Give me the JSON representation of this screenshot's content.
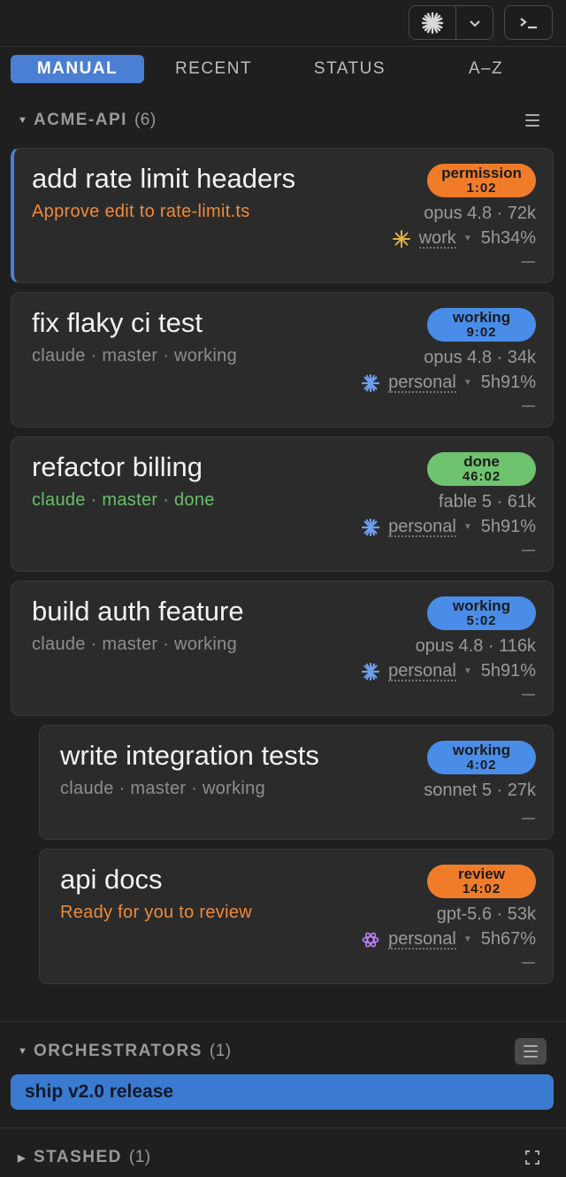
{
  "toolbar": {
    "provider_icon": "claude-sparkle-icon",
    "dropdown_icon": "chevron-down-icon",
    "terminal_icon": "terminal-icon"
  },
  "tabs": [
    {
      "label": "MANUAL",
      "active": true
    },
    {
      "label": "RECENT",
      "active": false
    },
    {
      "label": "STATUS",
      "active": false
    },
    {
      "label": "A–Z",
      "active": false
    }
  ],
  "groups": {
    "acme": {
      "label": "ACME-API",
      "count": "(6)"
    },
    "orchestrators": {
      "label": "ORCHESTRATORS",
      "count": "(1)"
    },
    "stashed": {
      "label": "STASHED",
      "count": "(1)"
    }
  },
  "sessions": [
    {
      "title": "add rate limit headers",
      "subtitle": "Approve edit to rate-limit.ts",
      "status": "permission",
      "time": "1:02",
      "model": "opus 4.8 · 72k",
      "account": "work",
      "usage": "5h34%",
      "color": "#f07c2a"
    },
    {
      "title": "fix flaky ci test",
      "subtitle": "claude · master · working",
      "status": "working",
      "time": "9:02",
      "model": "opus 4.8 · 34k",
      "account": "personal",
      "usage": "5h91%",
      "color": "#4a8de8"
    },
    {
      "title": "refactor billing",
      "subtitle": "claude · master · done",
      "status": "done",
      "time": "46:02",
      "model": "fable 5 · 61k",
      "account": "personal",
      "usage": "5h91%",
      "color": "#6fc36f"
    },
    {
      "title": "build auth feature",
      "subtitle": "claude · master · working",
      "status": "working",
      "time": "5:02",
      "model": "opus 4.8 · 116k",
      "account": "personal",
      "usage": "5h91%",
      "color": "#4a8de8"
    },
    {
      "title": "write integration tests",
      "subtitle": "claude · master · working",
      "status": "working",
      "time": "4:02",
      "model": "sonnet 5 · 27k",
      "color": "#4a8de8"
    },
    {
      "title": "api docs",
      "subtitle": "Ready for you to review",
      "status": "review",
      "time": "14:02",
      "model": "gpt-5.6 · 53k",
      "account": "personal",
      "usage": "5h67%",
      "color": "#f07c2a"
    }
  ],
  "placeholder_dash": "—",
  "orchestrators": [
    {
      "label": "ship v2.0 release"
    }
  ]
}
